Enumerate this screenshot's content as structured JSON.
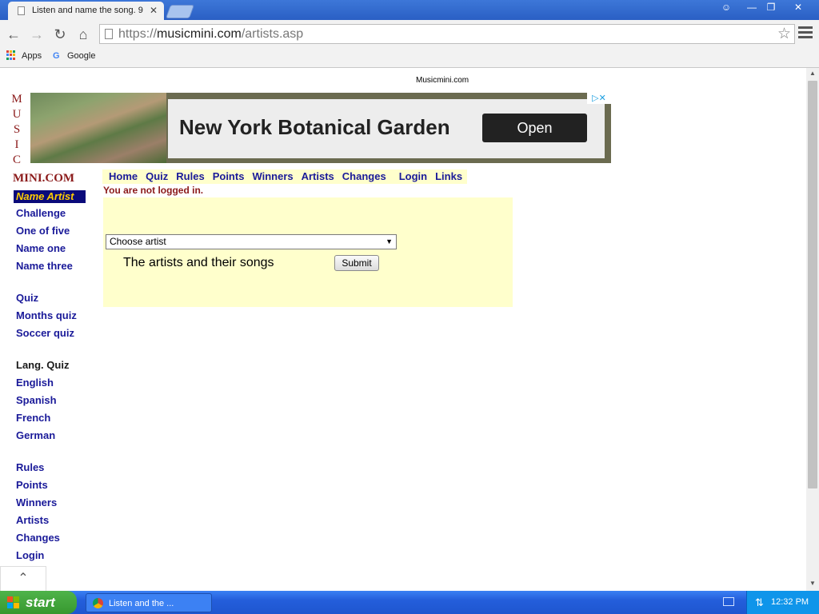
{
  "browser": {
    "tab_title": "Listen and name the song. 9",
    "url_scheme": "https://",
    "url_domain": "musicmini.com",
    "url_path": "/artists.asp"
  },
  "bookmarks": [
    {
      "label": "Apps"
    },
    {
      "label": "Google"
    }
  ],
  "site": {
    "header_text": "Musicmini.com",
    "logo_letters": [
      "M",
      "U",
      "S",
      "I",
      "C"
    ],
    "logo_mini": "MINI.COM"
  },
  "ad": {
    "headline": "New York Botanical Garden",
    "button": "Open"
  },
  "topnav": [
    "Home",
    "Quiz",
    "Rules",
    "Points",
    "Winners",
    "Artists",
    "Changes",
    "Login",
    "Links"
  ],
  "login_status": "You are not logged in.",
  "leftnav": {
    "active": "Name Artist",
    "group1": [
      "Challenge",
      "One of five",
      "Name one",
      "Name three"
    ],
    "group2": [
      "Quiz",
      "Months quiz",
      "Soccer quiz"
    ],
    "group3_heading": "Lang. Quiz",
    "group3": [
      "English",
      "Spanish",
      "French",
      "German"
    ],
    "group4": [
      "Rules",
      "Points",
      "Winners",
      "Artists",
      "Changes",
      "Login"
    ]
  },
  "form": {
    "select_value": "Choose artist",
    "songs_label": "The artists and their songs",
    "submit_label": "Submit"
  },
  "taskbar": {
    "start_label": "start",
    "item_label": "Listen and the ...",
    "clock": "12:32 PM"
  },
  "colors": {
    "nav_link": "#1a1a99",
    "logo_red": "#8b1a1a",
    "form_bg": "#ffffcc",
    "taskbar_blue": "#245edb",
    "start_green": "#37982f"
  }
}
